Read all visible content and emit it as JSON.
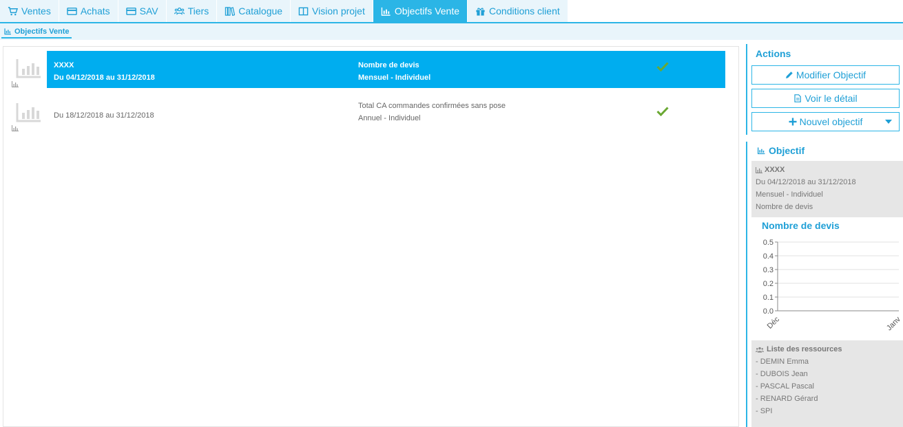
{
  "tabs": [
    {
      "label": "Ventes",
      "icon": "cart-icon",
      "active": false
    },
    {
      "label": "Achats",
      "icon": "card-icon",
      "active": false
    },
    {
      "label": "SAV",
      "icon": "card-icon",
      "active": false
    },
    {
      "label": "Tiers",
      "icon": "users-icon",
      "active": false
    },
    {
      "label": "Catalogue",
      "icon": "books-icon",
      "active": false
    },
    {
      "label": "Vision projet",
      "icon": "columns-icon",
      "active": false
    },
    {
      "label": "Objectifs Vente",
      "icon": "chart-icon",
      "active": true
    },
    {
      "label": "Conditions client",
      "icon": "gift-icon",
      "active": false
    }
  ],
  "subnav": {
    "label": "Objectifs Vente"
  },
  "objectives": [
    {
      "name": "XXXX",
      "period": "Du 04/12/2018 au 31/12/2018",
      "metric": "Nombre de devis",
      "frequency": "Mensuel - Individuel",
      "selected": true
    },
    {
      "name": "",
      "period": "Du 18/12/2018 au 31/12/2018",
      "metric": "Total CA commandes confirmées sans pose",
      "frequency": "Annuel - Individuel",
      "selected": false
    }
  ],
  "actions": {
    "title": "Actions",
    "modify": "Modifier Objectif",
    "detail": "Voir le détail",
    "new": "Nouvel objectif"
  },
  "objectif": {
    "title": "Objectif",
    "name": "XXXX",
    "period": "Du 04/12/2018 au 31/12/2018",
    "frequency": "Mensuel - Individuel",
    "metric": "Nombre de devis"
  },
  "chart_data": {
    "type": "line",
    "title": "Nombre de devis",
    "categories": [
      "Déc",
      "Janv"
    ],
    "y_ticks": [
      "0.5",
      "0.4",
      "0.3",
      "0.2",
      "0.1",
      "0.0"
    ],
    "ylim": [
      0,
      0.5
    ],
    "series": [],
    "grid": true
  },
  "resources": {
    "title": "Liste des ressources",
    "items": [
      "- DEMIN Emma",
      "- DUBOIS Jean",
      "- PASCAL Pascal",
      "- RENARD Gérard",
      "- SPI"
    ]
  },
  "colors": {
    "accent": "#2bb5e6",
    "selected": "#00adef",
    "check": "#6aa832"
  }
}
